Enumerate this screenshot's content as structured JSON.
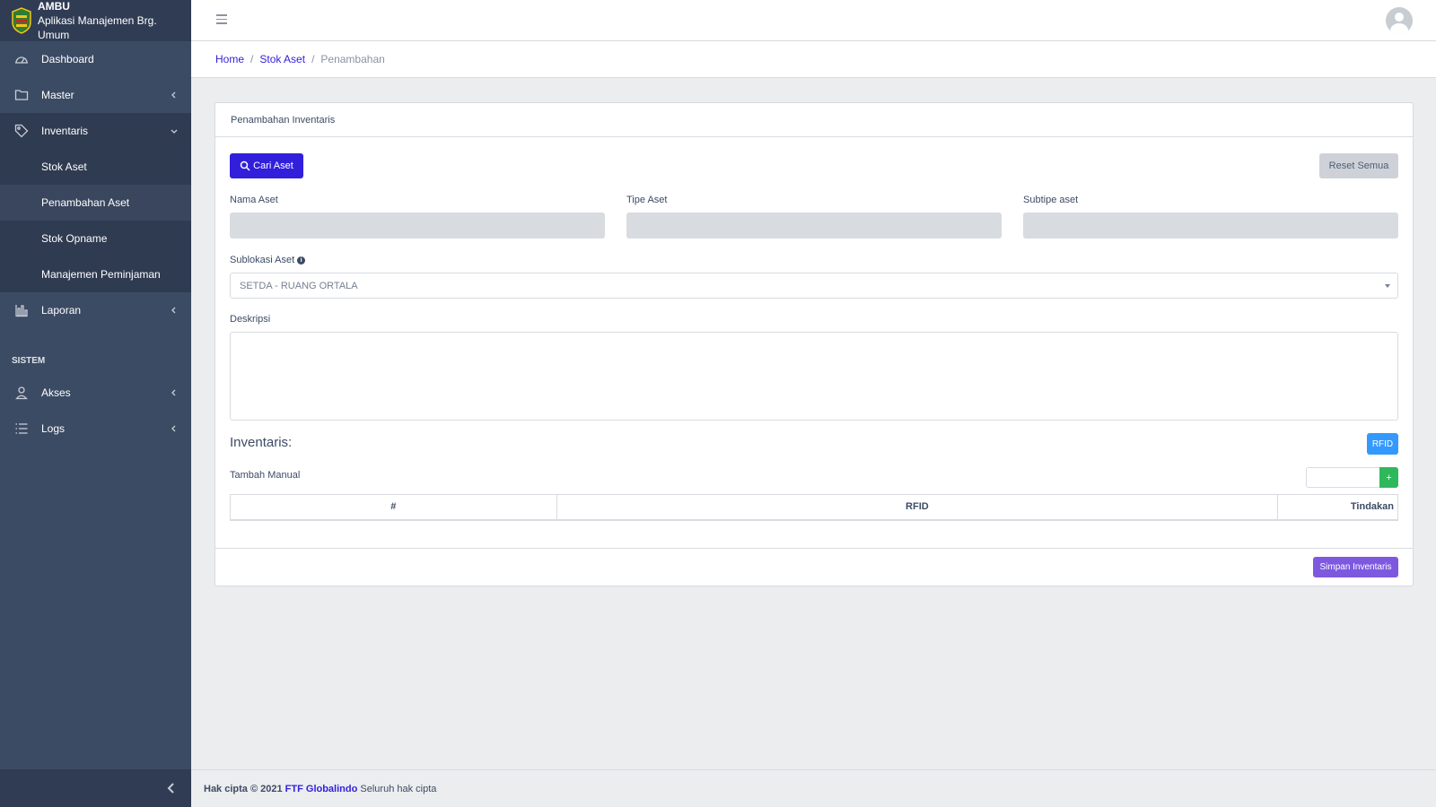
{
  "brand": {
    "name": "AMBU",
    "subtitle": "Aplikasi Manajemen Brg. Umum"
  },
  "sidebar": {
    "items": [
      {
        "label": "Dashboard",
        "icon": "speedometer-icon"
      },
      {
        "label": "Master",
        "icon": "folder-icon"
      },
      {
        "label": "Inventaris",
        "icon": "tag-icon"
      }
    ],
    "inventaris_sub": [
      {
        "label": "Stok Aset"
      },
      {
        "label": "Penambahan Aset"
      },
      {
        "label": "Stok Opname"
      },
      {
        "label": "Manajemen Peminjaman"
      }
    ],
    "laporan": {
      "label": "Laporan",
      "icon": "chart-icon"
    },
    "section_title": "SISTEM",
    "system_items": [
      {
        "label": "Akses",
        "icon": "user-icon"
      },
      {
        "label": "Logs",
        "icon": "list-icon"
      }
    ]
  },
  "breadcrumb": {
    "home": "Home",
    "stok": "Stok Aset",
    "current": "Penambahan",
    "sep": "/"
  },
  "card": {
    "title": "Penambahan Inventaris",
    "cari_label": "Cari Aset",
    "reset_label": "Reset Semua",
    "nama_label": "Nama Aset",
    "tipe_label": "Tipe Aset",
    "subtipe_label": "Subtipe aset",
    "sublokasi_label": "Sublokasi Aset",
    "sublokasi_value": "SETDA - RUANG ORTALA",
    "deskripsi_label": "Deskripsi",
    "inventaris_heading": "Inventaris:",
    "rfid_button": "RFID",
    "tambah_manual": "Tambah Manual",
    "add_button": "+",
    "table_headers": [
      "#",
      "RFID",
      "Tindakan"
    ],
    "simpan_label": "Simpan Inventaris"
  },
  "footer": {
    "prefix": "Hak cipta © 2021",
    "company": "FTF Globalindo",
    "suffix": "Seluruh hak cipta"
  }
}
